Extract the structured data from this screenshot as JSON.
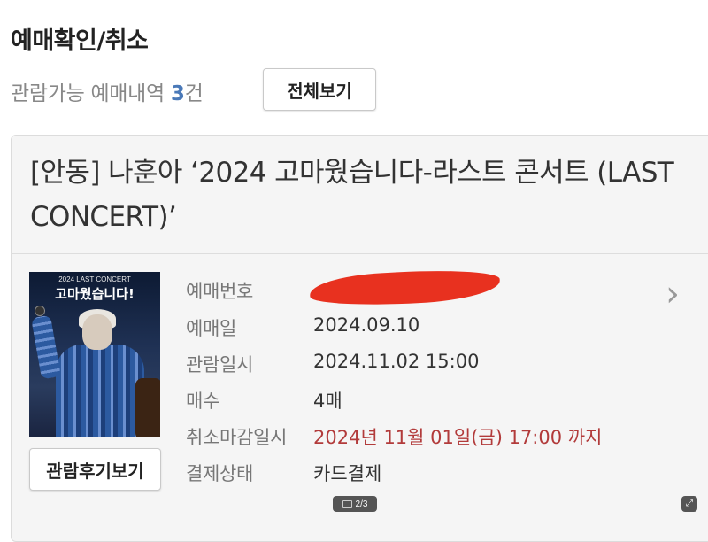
{
  "header": {
    "title": "예매확인/취소",
    "summary_prefix": "관람가능 예매내역 ",
    "summary_count": "3",
    "summary_suffix": "건",
    "view_all_label": "전체보기"
  },
  "booking": {
    "title": "[안동] 나훈아 ‘2024 고마웠습니다-라스트 콘서트 (LAST CONCERT)’",
    "poster": {
      "subtitle": "2024 LAST CONCERT",
      "headline": "고마웠습니다!"
    },
    "review_button_label": "관람후기보기",
    "fields": [
      {
        "label": "예매번호",
        "value": ""
      },
      {
        "label": "예매일",
        "value": "2024.09.10"
      },
      {
        "label": "관람일시",
        "value": "2024.11.02 15:00"
      },
      {
        "label": "매수",
        "value": "4매"
      },
      {
        "label": "취소마감일시",
        "value": "2024년 11월 01일(금) 17:00 까지"
      },
      {
        "label": "결제상태",
        "value": "카드결제"
      }
    ],
    "accent_color": "#b23b3b"
  },
  "gallery": {
    "pager_text": "2/3"
  },
  "icons": [
    "chevron-right-icon",
    "image-icon",
    "expand-icon"
  ]
}
